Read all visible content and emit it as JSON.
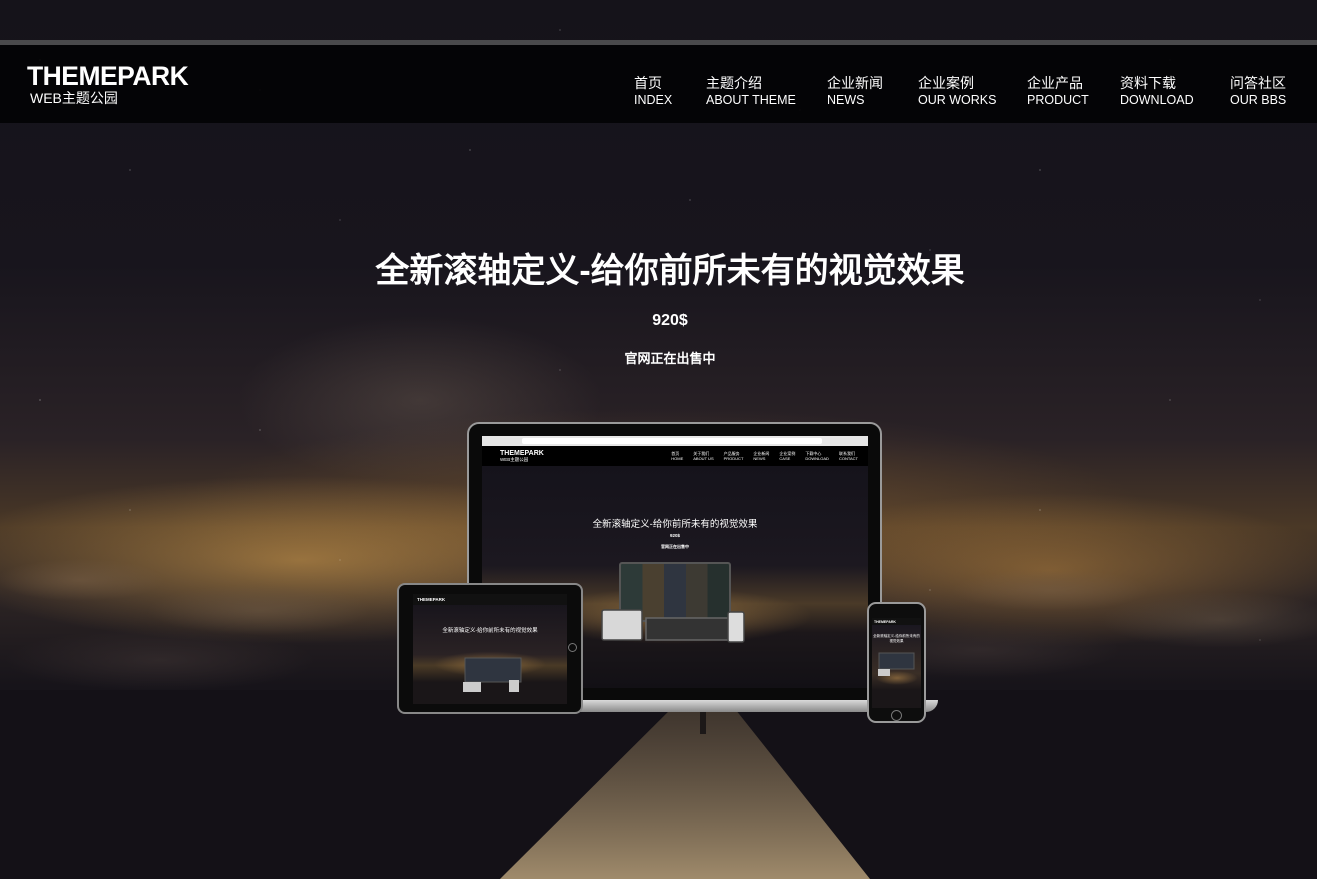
{
  "logo": {
    "main": "THEMEPARK",
    "sub": "WEB主题公园"
  },
  "nav": [
    {
      "cn": "首页",
      "en": "INDEX"
    },
    {
      "cn": "主题介绍",
      "en": "ABOUT THEME"
    },
    {
      "cn": "企业新闻",
      "en": "NEWS"
    },
    {
      "cn": "企业案例",
      "en": "OUR WORKS"
    },
    {
      "cn": "企业产品",
      "en": "PRODUCT"
    },
    {
      "cn": "资料下载",
      "en": "DOWNLOAD"
    },
    {
      "cn": "问答社区",
      "en": "OUR BBS"
    }
  ],
  "hero": {
    "title": "全新滚轴定义-给你前所未有的视觉效果",
    "price": "920$",
    "status": "官网正在出售中"
  },
  "mockup": {
    "nav": [
      "首页",
      "关于我们",
      "产品服务",
      "企业新闻",
      "企业案例",
      "下载中心",
      "联系我们"
    ],
    "nav_en": [
      "HOME",
      "ABOUT US",
      "PRODUCT",
      "NEWS",
      "CASE",
      "DOWNLOAD",
      "CONTACT"
    ],
    "price": "920$"
  },
  "colors": {
    "header_bg": "#030304",
    "accent_glow": "#dea652",
    "text": "#ffffff"
  }
}
